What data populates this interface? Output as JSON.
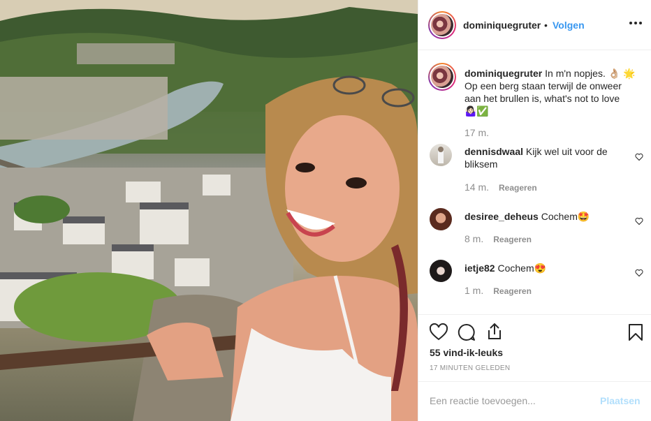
{
  "post": {
    "username": "dominiquegruter",
    "separator": "•",
    "follow_label": "Volgen",
    "more_icon": "more-options-icon",
    "caption": {
      "username": "dominiquegruter",
      "text": "In m'n nopjes. 👌🏼 🌟Op een berg staan terwijl de onweer aan het brullen is, what's not to love 🤷🏻‍♀️✅",
      "time": "17 m."
    }
  },
  "comments": [
    {
      "username": "dennisdwaal",
      "text": "Kijk wel uit voor de bliksem",
      "time": "14 m.",
      "reply_label": "Reageren"
    },
    {
      "username": "desiree_deheus",
      "text": "Cochem🤩",
      "time": "8 m.",
      "reply_label": "Reageren"
    },
    {
      "username": "ietje82",
      "text": "Cochem😍",
      "time": "1 m.",
      "reply_label": "Reageren"
    }
  ],
  "actions": {
    "like_icon": "heart-icon",
    "comment_icon": "comment-icon",
    "share_icon": "share-icon",
    "save_icon": "bookmark-icon",
    "likes": "55 vind-ik-leuks",
    "time_ago": "17 MINUTEN GELEDEN"
  },
  "add_comment": {
    "placeholder": "Een reactie toevoegen...",
    "post_label": "Plaatsen"
  },
  "colors": {
    "link": "#3897f0",
    "post_disabled": "#b2dffc",
    "muted": "#8e8e8e"
  }
}
